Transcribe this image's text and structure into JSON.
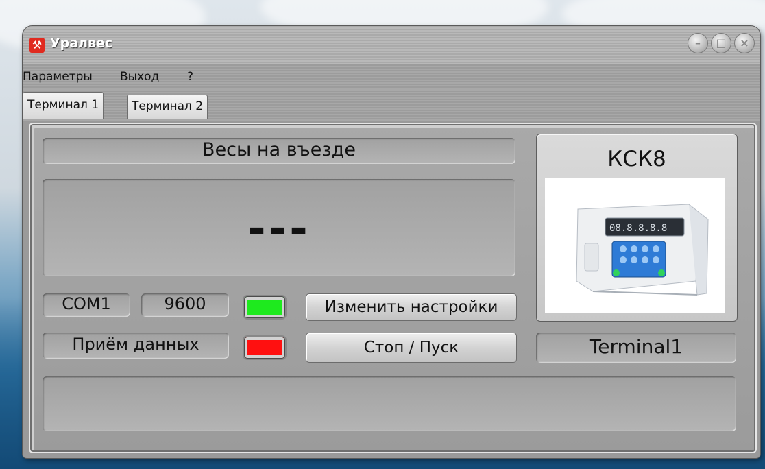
{
  "window": {
    "title": "Уралвес"
  },
  "menu": {
    "items": [
      "Параметры",
      "Выход",
      "?"
    ]
  },
  "tabs": [
    {
      "label": "Терминал 1",
      "active": true
    },
    {
      "label": "Терминал 2",
      "active": false
    }
  ],
  "scale": {
    "name": "Весы на въезде",
    "reading": "---",
    "port": "COM1",
    "baud": "9600",
    "receive_label": "Приём данных",
    "change_settings_button": "Изменить  настройки",
    "stop_start_button": "Стоп / Пуск",
    "status_message": ""
  },
  "device": {
    "model": "КСК8",
    "terminal_name": "Terminal1"
  },
  "colors": {
    "connection_led": "#1eea1e",
    "receive_led": "#ff1010"
  }
}
